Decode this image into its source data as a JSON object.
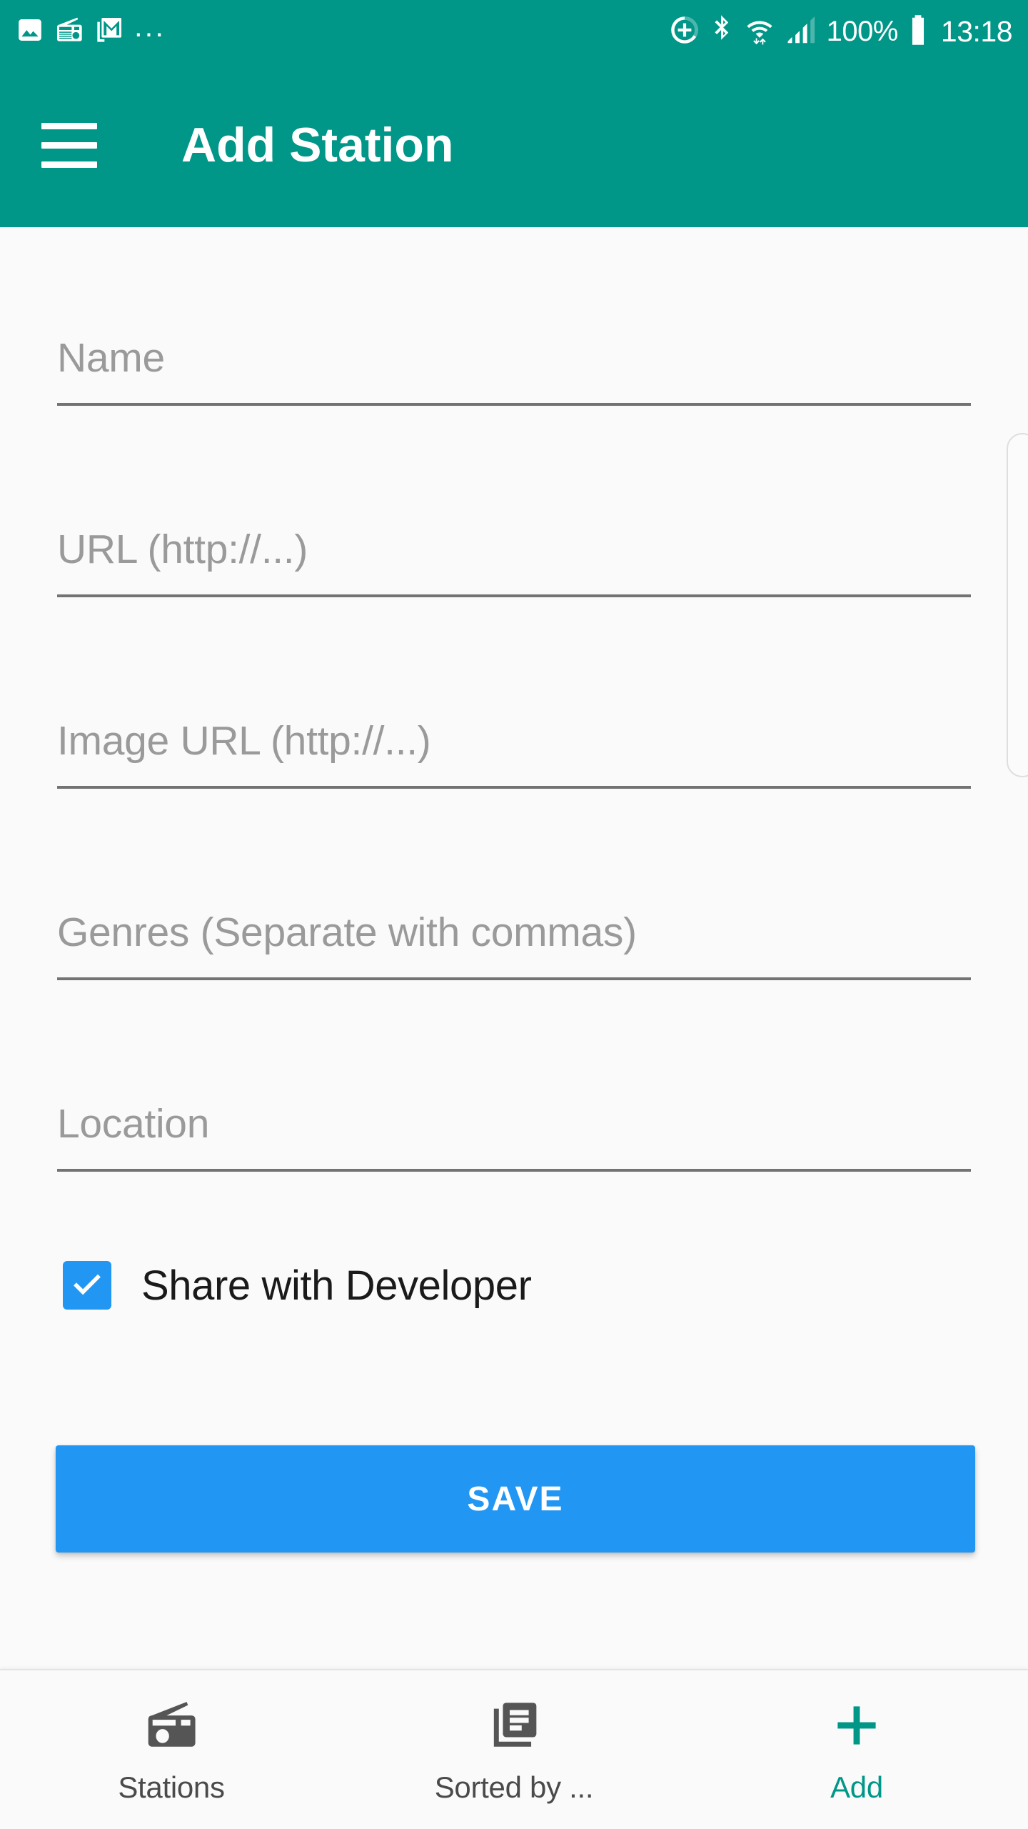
{
  "theme": {
    "primary": "#009688",
    "accent_blue": "#2196f3",
    "background": "#fafafa",
    "placeholder_text": "#9a9a9a",
    "nav_inactive": "#4a4a4a",
    "nav_active": "#009688"
  },
  "status_bar": {
    "left_icons": [
      "photo-icon",
      "radio-icon",
      "gmail-icon",
      "more-icons-ellipsis"
    ],
    "ellipsis": "...",
    "right_icons": [
      "data-saver-icon",
      "bluetooth-icon",
      "wifi-icon",
      "cellular-signal-icon",
      "battery-icon"
    ],
    "battery_percent": "100%",
    "clock": "13:18"
  },
  "app_bar": {
    "menu_icon": "hamburger-menu-icon",
    "title": "Add Station"
  },
  "form": {
    "fields": [
      {
        "name": "name",
        "placeholder": "Name",
        "value": ""
      },
      {
        "name": "url",
        "placeholder": "URL (http://...)",
        "value": ""
      },
      {
        "name": "image_url",
        "placeholder": "Image URL (http://...)",
        "value": ""
      },
      {
        "name": "genres",
        "placeholder": "Genres (Separate with commas)",
        "value": ""
      },
      {
        "name": "location",
        "placeholder": "Location",
        "value": ""
      }
    ],
    "share_checkbox": {
      "label": "Share with Developer",
      "checked": true
    },
    "save_button": {
      "label": "SAVE"
    }
  },
  "bottom_nav": {
    "items": [
      {
        "label": "Stations",
        "icon": "radio-icon",
        "active": false
      },
      {
        "label": "Sorted by ...",
        "icon": "library-list-icon",
        "active": false
      },
      {
        "label": "Add",
        "icon": "plus-icon",
        "active": true
      }
    ]
  }
}
